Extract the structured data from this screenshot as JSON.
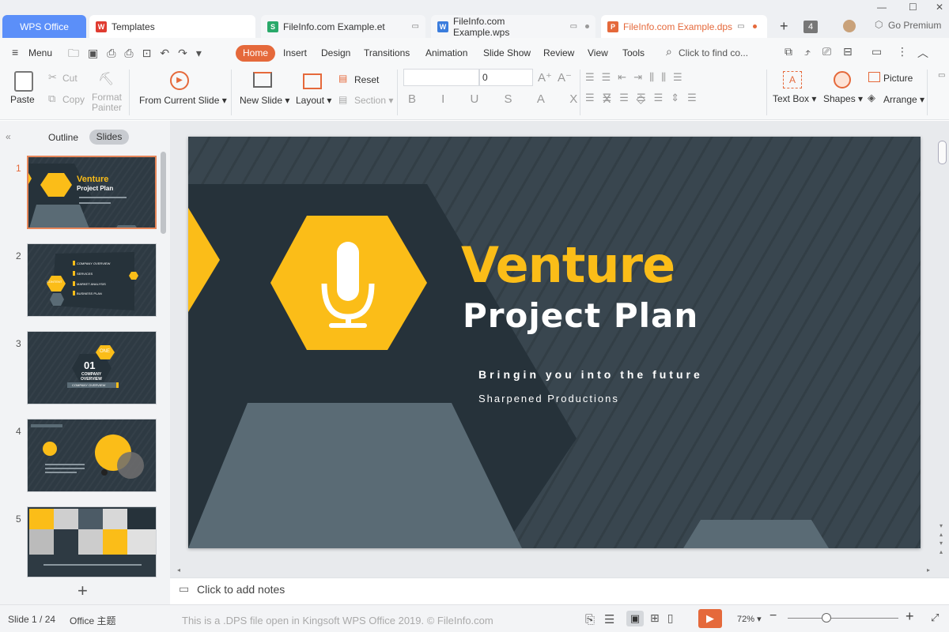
{
  "tabs": {
    "home": "WPS Office",
    "templates": "Templates",
    "et": "FileInfo.com Example.et",
    "wps": "FileInfo.com Example.wps",
    "dps": "FileInfo.com Example.dps",
    "count": "4",
    "premium": "Go Premium"
  },
  "menu": {
    "menu_label": "Menu",
    "items": [
      "Home",
      "Insert",
      "Design",
      "Transitions",
      "Animation",
      "Slide Show",
      "Review",
      "View",
      "Tools"
    ],
    "search_placeholder": "Click to find co..."
  },
  "ribbon": {
    "paste": "Paste",
    "cut": "Cut",
    "copy": "Copy",
    "format_painter_1": "Format",
    "format_painter_2": "Painter",
    "from_current": "From Current Slide",
    "new_slide": "New Slide",
    "layout": "Layout",
    "reset": "Reset",
    "section": "Section",
    "font_size": "0",
    "text_box": "Text Box",
    "shapes": "Shapes",
    "picture": "Picture",
    "arrange": "Arrange"
  },
  "panel": {
    "outline": "Outline",
    "slides": "Slides",
    "numbers": [
      "1",
      "2",
      "3",
      "4",
      "5"
    ],
    "thumb1_title": "Venture",
    "thumb1_sub": "Project Plan",
    "thumb2_items": [
      "COMPANY OVERVIEW",
      "SERVICES",
      "MARKET ANALYSIS",
      "BUSINESS PLAN"
    ],
    "thumb2_hex": "CONTENT",
    "thumb3_num": "01",
    "thumb3_one": "ONE",
    "thumb3_t1": "COMPANY",
    "thumb3_t2": "OVERVIEW",
    "thumb3_bar": "COMPANY OVERVIEW"
  },
  "slide": {
    "title": "Venture",
    "subtitle": "Project Plan",
    "tagline": "Bringin you into the future",
    "company": "Sharpened Productions"
  },
  "notes": "Click to add notes",
  "status": {
    "slide_of": "Slide 1 / 24",
    "theme": "Office 主题",
    "caption": "This is a .DPS file open in Kingsoft WPS Office 2019. © FileInfo.com",
    "zoom": "72%"
  },
  "colors": {
    "accent": "#e5693b",
    "slide_bg": "#39464f",
    "hex_yellow": "#fbbd18",
    "gray_shape": "#5a6b75"
  }
}
